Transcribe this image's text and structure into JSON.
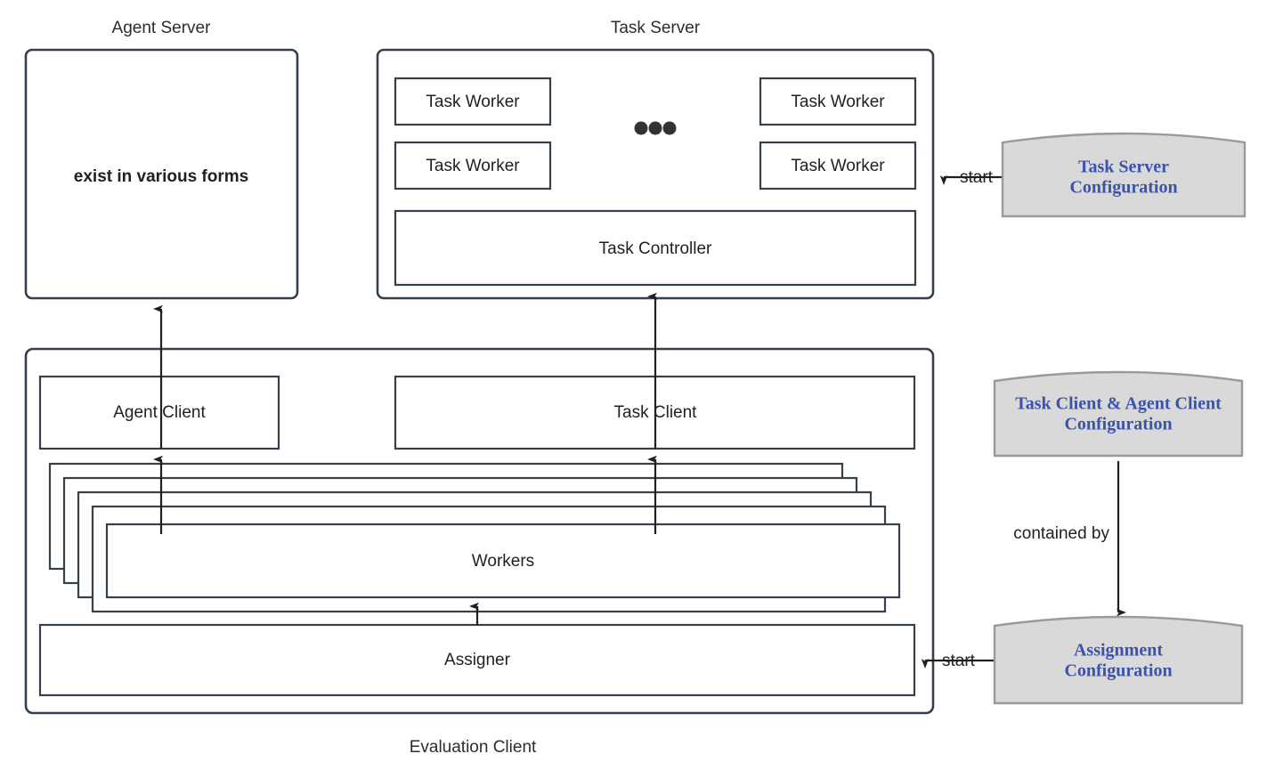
{
  "diagram": {
    "title_labels": {
      "agent_server": "Agent Server",
      "task_server": "Task Server",
      "evaluation_client": "Evaluation Client"
    },
    "agent_server": {
      "note": "exist in various forms"
    },
    "task_server": {
      "workers": [
        "Task Worker",
        "Task Worker",
        "Task Worker",
        "Task Worker"
      ],
      "ellipsis": "•••",
      "controller": "Task Controller"
    },
    "evaluation_client": {
      "agent_client": "Agent Client",
      "task_client": "Task Client",
      "workers": "Workers",
      "assigner": "Assigner"
    },
    "configs": [
      {
        "id": "task-server-configuration",
        "line1": "Task Server",
        "line2": "Configuration"
      },
      {
        "id": "task-client-agent-client-configuration",
        "line1": "Task Client & Agent Client",
        "line2": "Configuration"
      },
      {
        "id": "assignment-configuration",
        "line1": "Assignment",
        "line2": "Configuration"
      }
    ],
    "edge_labels": {
      "start_task_server": "start",
      "start_assigner": "start",
      "contained_by": "contained by"
    },
    "colors": {
      "stroke": "#36404a",
      "edge": "#231f20",
      "config_fill": "#d9d9d9",
      "config_stroke": "#9a9a9a",
      "config_text": "#3b53ab",
      "background": "#ffffff"
    }
  }
}
